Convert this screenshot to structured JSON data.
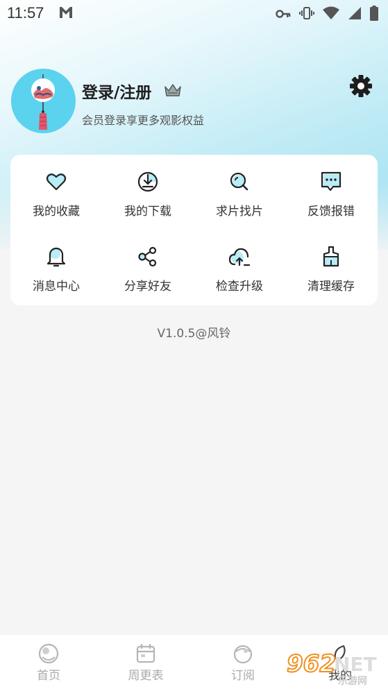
{
  "status_bar": {
    "time": "11:57",
    "notification_icon": "gmail-icon",
    "icons": [
      "key-icon",
      "vibrate-icon",
      "wifi-icon",
      "signal-icon",
      "battery-icon"
    ]
  },
  "profile": {
    "title": "登录/注册",
    "subtitle": "会员登录享更多观影权益",
    "badge_icon": "crown-icon",
    "settings_icon": "gear-icon"
  },
  "menu": {
    "items": [
      {
        "label": "我的收藏",
        "icon": "heart-icon"
      },
      {
        "label": "我的下载",
        "icon": "download-icon"
      },
      {
        "label": "求片找片",
        "icon": "search-film-icon"
      },
      {
        "label": "反馈报错",
        "icon": "feedback-icon"
      },
      {
        "label": "消息中心",
        "icon": "bell-icon"
      },
      {
        "label": "分享好友",
        "icon": "share-icon"
      },
      {
        "label": "检查升级",
        "icon": "cloud-upload-icon"
      },
      {
        "label": "清理缓存",
        "icon": "clean-icon"
      }
    ]
  },
  "version": "V1.0.5@风铃",
  "bottom_nav": {
    "items": [
      {
        "label": "首页",
        "icon": "home-icon"
      },
      {
        "label": "周更表",
        "icon": "calendar-icon"
      },
      {
        "label": "订阅",
        "icon": "subscribe-icon"
      },
      {
        "label": "我的",
        "icon": "profile-icon"
      }
    ]
  },
  "watermark": {
    "number": "962",
    "suffix": "NET",
    "subtitle": "乐游网"
  },
  "colors": {
    "accent": "#5bd3ee",
    "card": "#ffffff",
    "background": "#f5f5f5",
    "nav_text": "#aaaaaa"
  }
}
